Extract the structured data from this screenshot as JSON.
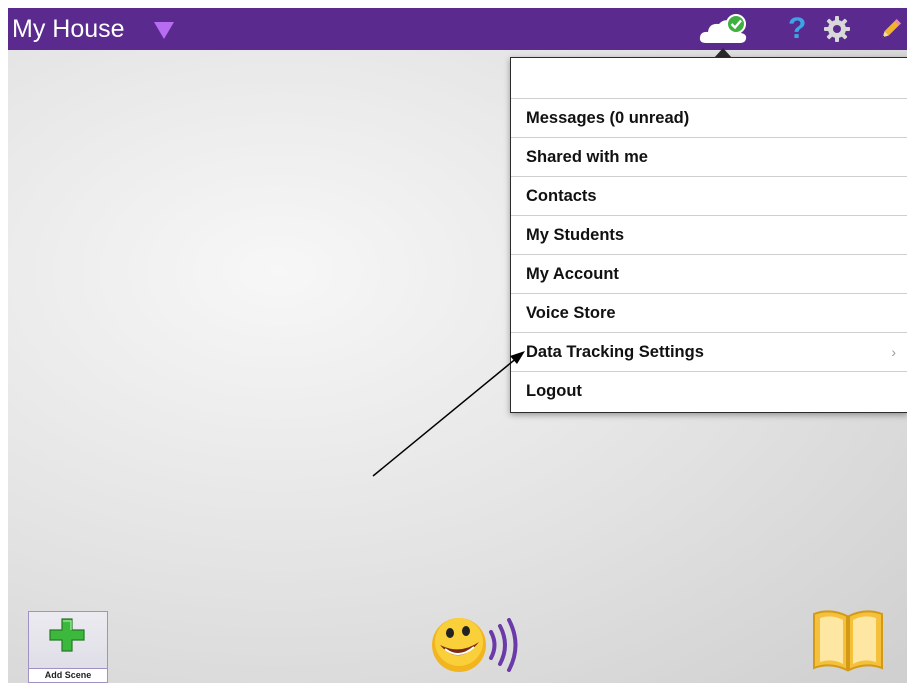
{
  "header": {
    "title": "My House",
    "icons": [
      "dropdown-triangle-icon",
      "cloud-sync-icon",
      "help-icon",
      "gear-icon",
      "pencil-icon"
    ],
    "help_glyph": "?"
  },
  "account_menu": {
    "items": [
      {
        "label": "Messages (0 unread)"
      },
      {
        "label": "Shared with me"
      },
      {
        "label": "Contacts"
      },
      {
        "label": "My Students"
      },
      {
        "label": "My Account"
      },
      {
        "label": "Voice Store"
      },
      {
        "label": "Data Tracking Settings",
        "chevron": "›"
      },
      {
        "label": "Logout"
      }
    ]
  },
  "footer": {
    "add_scene_label": "Add Scene",
    "icons": [
      "plus-icon",
      "smiley-speak-icon",
      "book-icon"
    ]
  },
  "colors": {
    "header_bg": "#5a2a8e",
    "accent_purple": "#b86cf2",
    "help_blue": "#3da5e6",
    "plus_green": "#3cb83c",
    "book_yellow": "#f5c03b"
  }
}
